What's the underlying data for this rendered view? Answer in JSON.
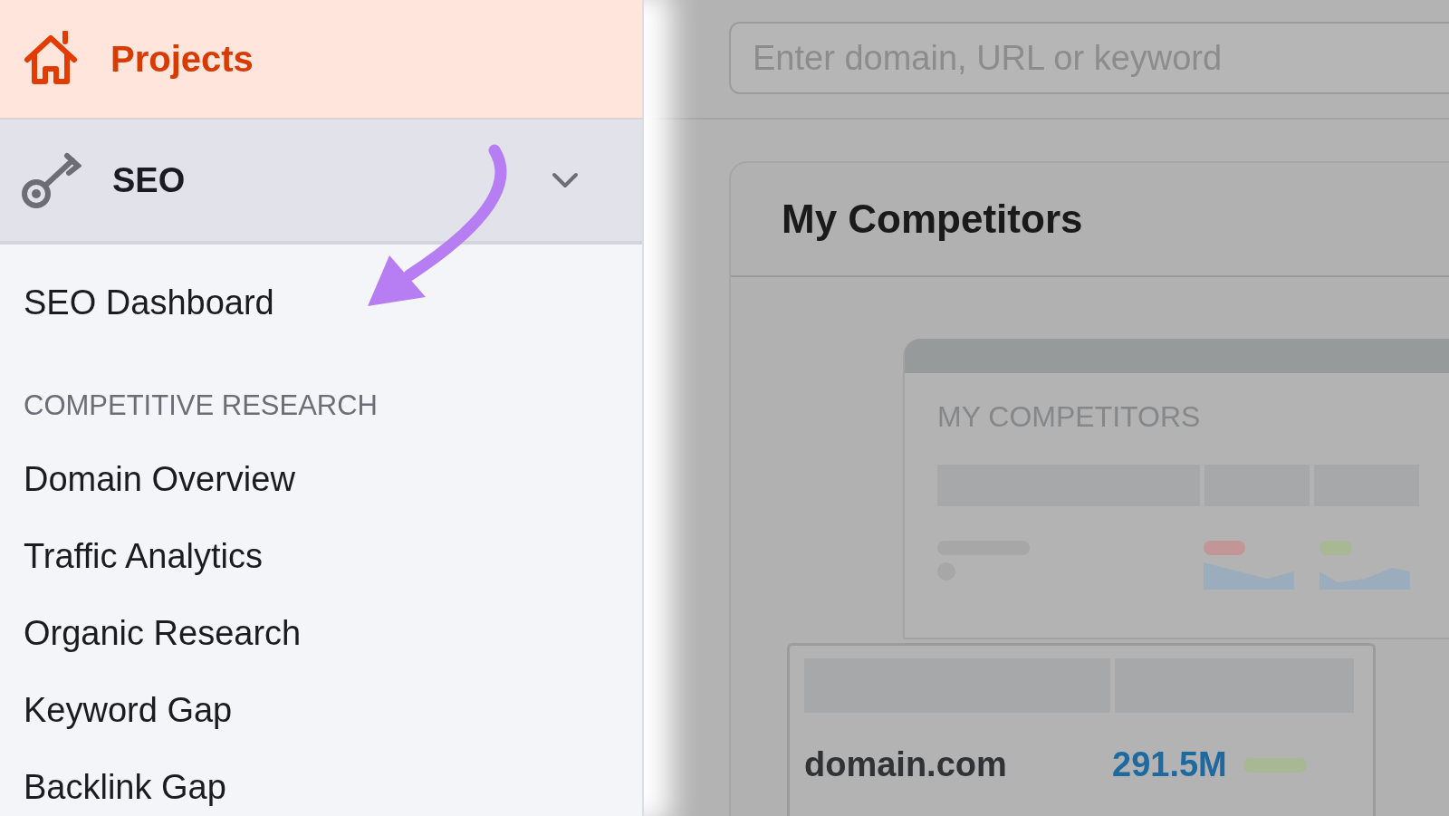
{
  "sidebar": {
    "projects": {
      "label": "Projects"
    },
    "section": {
      "label": "SEO",
      "expanded": true
    },
    "items": [
      {
        "kind": "link",
        "label": "SEO Dashboard"
      },
      {
        "kind": "heading",
        "label": "COMPETITIVE RESEARCH"
      },
      {
        "kind": "link",
        "label": "Domain Overview"
      },
      {
        "kind": "link",
        "label": "Traffic Analytics"
      },
      {
        "kind": "link",
        "label": "Organic Research"
      },
      {
        "kind": "link",
        "label": "Keyword Gap"
      },
      {
        "kind": "link",
        "label": "Backlink Gap"
      }
    ]
  },
  "search": {
    "placeholder": "Enter domain, URL or keyword"
  },
  "widget": {
    "title": "My Competitors",
    "preview": {
      "title": "MY COMPETITORS",
      "domain": "domain.com",
      "value": "291.5M"
    }
  }
}
